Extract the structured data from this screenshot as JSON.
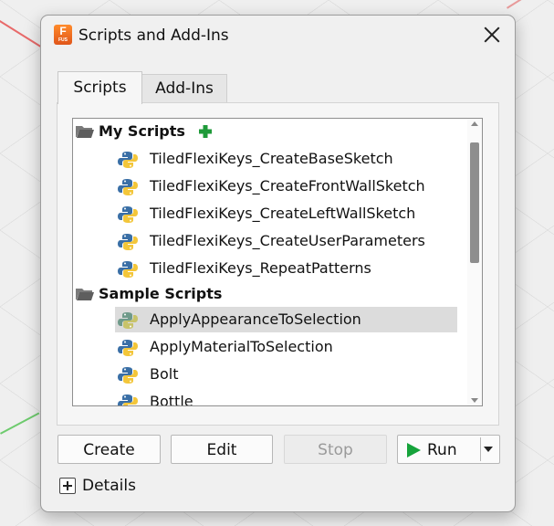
{
  "window": {
    "title": "Scripts and Add-Ins",
    "app_icon_letter": "F",
    "app_icon_sub": "FUS",
    "app_icon_color": "#f47321"
  },
  "tabs": [
    {
      "label": "Scripts",
      "active": true
    },
    {
      "label": "Add-Ins",
      "active": false
    }
  ],
  "tree": {
    "my_scripts": {
      "label": "My Scripts",
      "add_icon": "green-plus-icon",
      "items": [
        "TiledFlexiKeys_CreateBaseSketch",
        "TiledFlexiKeys_CreateFrontWallSketch",
        "TiledFlexiKeys_CreateLeftWallSketch",
        "TiledFlexiKeys_CreateUserParameters",
        "TiledFlexiKeys_RepeatPatterns"
      ]
    },
    "sample_scripts": {
      "label": "Sample Scripts",
      "items": [
        "ApplyAppearanceToSelection",
        "ApplyMaterialToSelection",
        "Bolt",
        "Bottle"
      ],
      "selected_index": 0
    }
  },
  "buttons": {
    "create": "Create",
    "edit": "Edit",
    "stop": "Stop",
    "run": "Run"
  },
  "details": {
    "label": "Details"
  },
  "colors": {
    "run_accent": "#16a33b",
    "selection": "#dcdcdc",
    "plus_accent": "#1f9a3a"
  }
}
